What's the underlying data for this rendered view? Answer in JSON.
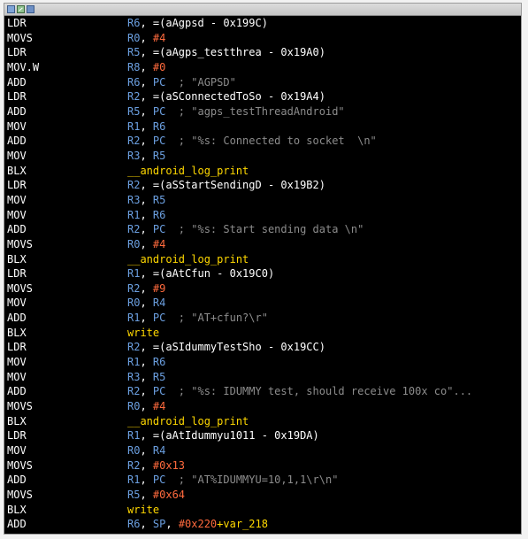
{
  "colors": {
    "background": "#000000",
    "mnemonic": "#ffffff",
    "register": "#6b9fe0",
    "immediate": "#ff6a3d",
    "function": "#ffd800",
    "comment": "#8c8c8c"
  },
  "titlebar": {
    "icons": [
      "view-icon",
      "graph-icon",
      "grid-icon"
    ]
  },
  "lines": [
    {
      "m": "LDR",
      "ops": [
        {
          "t": "R6",
          "k": "reg"
        },
        {
          "t": ", =(aAgpsd - 0x199C)",
          "k": "sym"
        }
      ]
    },
    {
      "m": "MOVS",
      "ops": [
        {
          "t": "R0",
          "k": "reg"
        },
        {
          "t": ", ",
          "k": "txt"
        },
        {
          "t": "#4",
          "k": "imm"
        }
      ]
    },
    {
      "m": "LDR",
      "ops": [
        {
          "t": "R5",
          "k": "reg"
        },
        {
          "t": ", =(aAgps_testthrea - 0x19A0)",
          "k": "sym"
        }
      ]
    },
    {
      "m": "MOV.W",
      "ops": [
        {
          "t": "R8",
          "k": "reg"
        },
        {
          "t": ", ",
          "k": "txt"
        },
        {
          "t": "#0",
          "k": "imm"
        }
      ]
    },
    {
      "m": "ADD",
      "ops": [
        {
          "t": "R6",
          "k": "reg"
        },
        {
          "t": ", ",
          "k": "txt"
        },
        {
          "t": "PC",
          "k": "reg"
        },
        {
          "t": "  ; \"AGPSD\"",
          "k": "cmt"
        }
      ]
    },
    {
      "m": "LDR",
      "ops": [
        {
          "t": "R2",
          "k": "reg"
        },
        {
          "t": ", =(aSConnectedToSo - 0x19A4)",
          "k": "sym"
        }
      ]
    },
    {
      "m": "ADD",
      "ops": [
        {
          "t": "R5",
          "k": "reg"
        },
        {
          "t": ", ",
          "k": "txt"
        },
        {
          "t": "PC",
          "k": "reg"
        },
        {
          "t": "  ; \"agps_testThreadAndroid\"",
          "k": "cmt"
        }
      ]
    },
    {
      "m": "MOV",
      "ops": [
        {
          "t": "R1",
          "k": "reg"
        },
        {
          "t": ", ",
          "k": "txt"
        },
        {
          "t": "R6",
          "k": "reg"
        }
      ]
    },
    {
      "m": "ADD",
      "ops": [
        {
          "t": "R2",
          "k": "reg"
        },
        {
          "t": ", ",
          "k": "txt"
        },
        {
          "t": "PC",
          "k": "reg"
        },
        {
          "t": "  ; \"%s: Connected to socket  \\n\"",
          "k": "cmt"
        }
      ]
    },
    {
      "m": "MOV",
      "ops": [
        {
          "t": "R3",
          "k": "reg"
        },
        {
          "t": ", ",
          "k": "txt"
        },
        {
          "t": "R5",
          "k": "reg"
        }
      ]
    },
    {
      "m": "BLX",
      "ops": [
        {
          "t": "__android_log_print",
          "k": "func"
        }
      ]
    },
    {
      "m": "LDR",
      "ops": [
        {
          "t": "R2",
          "k": "reg"
        },
        {
          "t": ", =(aSStartSendingD - 0x19B2)",
          "k": "sym"
        }
      ]
    },
    {
      "m": "MOV",
      "ops": [
        {
          "t": "R3",
          "k": "reg"
        },
        {
          "t": ", ",
          "k": "txt"
        },
        {
          "t": "R5",
          "k": "reg"
        }
      ]
    },
    {
      "m": "MOV",
      "ops": [
        {
          "t": "R1",
          "k": "reg"
        },
        {
          "t": ", ",
          "k": "txt"
        },
        {
          "t": "R6",
          "k": "reg"
        }
      ]
    },
    {
      "m": "ADD",
      "ops": [
        {
          "t": "R2",
          "k": "reg"
        },
        {
          "t": ", ",
          "k": "txt"
        },
        {
          "t": "PC",
          "k": "reg"
        },
        {
          "t": "  ; \"%s: Start sending data \\n\"",
          "k": "cmt"
        }
      ]
    },
    {
      "m": "MOVS",
      "ops": [
        {
          "t": "R0",
          "k": "reg"
        },
        {
          "t": ", ",
          "k": "txt"
        },
        {
          "t": "#4",
          "k": "imm"
        }
      ]
    },
    {
      "m": "BLX",
      "ops": [
        {
          "t": "__android_log_print",
          "k": "func"
        }
      ]
    },
    {
      "m": "LDR",
      "ops": [
        {
          "t": "R1",
          "k": "reg"
        },
        {
          "t": ", =(aAtCfun - 0x19C0)",
          "k": "sym"
        }
      ]
    },
    {
      "m": "MOVS",
      "ops": [
        {
          "t": "R2",
          "k": "reg"
        },
        {
          "t": ", ",
          "k": "txt"
        },
        {
          "t": "#9",
          "k": "imm"
        }
      ]
    },
    {
      "m": "MOV",
      "ops": [
        {
          "t": "R0",
          "k": "reg"
        },
        {
          "t": ", ",
          "k": "txt"
        },
        {
          "t": "R4",
          "k": "reg"
        }
      ]
    },
    {
      "m": "ADD",
      "ops": [
        {
          "t": "R1",
          "k": "reg"
        },
        {
          "t": ", ",
          "k": "txt"
        },
        {
          "t": "PC",
          "k": "reg"
        },
        {
          "t": "  ; \"AT+cfun?\\r\"",
          "k": "cmt"
        }
      ]
    },
    {
      "m": "BLX",
      "ops": [
        {
          "t": "write",
          "k": "func"
        }
      ]
    },
    {
      "m": "LDR",
      "ops": [
        {
          "t": "R2",
          "k": "reg"
        },
        {
          "t": ", =(aSIdummyTestSho - 0x19CC)",
          "k": "sym"
        }
      ]
    },
    {
      "m": "MOV",
      "ops": [
        {
          "t": "R1",
          "k": "reg"
        },
        {
          "t": ", ",
          "k": "txt"
        },
        {
          "t": "R6",
          "k": "reg"
        }
      ]
    },
    {
      "m": "MOV",
      "ops": [
        {
          "t": "R3",
          "k": "reg"
        },
        {
          "t": ", ",
          "k": "txt"
        },
        {
          "t": "R5",
          "k": "reg"
        }
      ]
    },
    {
      "m": "ADD",
      "ops": [
        {
          "t": "R2",
          "k": "reg"
        },
        {
          "t": ", ",
          "k": "txt"
        },
        {
          "t": "PC",
          "k": "reg"
        },
        {
          "t": "  ; \"%s: IDUMMY test, should receive 100x co\"...",
          "k": "cmt"
        }
      ]
    },
    {
      "m": "MOVS",
      "ops": [
        {
          "t": "R0",
          "k": "reg"
        },
        {
          "t": ", ",
          "k": "txt"
        },
        {
          "t": "#4",
          "k": "imm"
        }
      ]
    },
    {
      "m": "BLX",
      "ops": [
        {
          "t": "__android_log_print",
          "k": "func"
        }
      ]
    },
    {
      "m": "LDR",
      "ops": [
        {
          "t": "R1",
          "k": "reg"
        },
        {
          "t": ", =(aAtIdummyu1011 - 0x19DA)",
          "k": "sym"
        }
      ]
    },
    {
      "m": "MOV",
      "ops": [
        {
          "t": "R0",
          "k": "reg"
        },
        {
          "t": ", ",
          "k": "txt"
        },
        {
          "t": "R4",
          "k": "reg"
        }
      ]
    },
    {
      "m": "MOVS",
      "ops": [
        {
          "t": "R2",
          "k": "reg"
        },
        {
          "t": ", ",
          "k": "txt"
        },
        {
          "t": "#0x13",
          "k": "imm"
        }
      ]
    },
    {
      "m": "ADD",
      "ops": [
        {
          "t": "R1",
          "k": "reg"
        },
        {
          "t": ", ",
          "k": "txt"
        },
        {
          "t": "PC",
          "k": "reg"
        },
        {
          "t": "  ; \"AT%IDUMMYU=10,1,1\\r\\n\"",
          "k": "cmt"
        }
      ]
    },
    {
      "m": "MOVS",
      "ops": [
        {
          "t": "R5",
          "k": "reg"
        },
        {
          "t": ", ",
          "k": "txt"
        },
        {
          "t": "#0x64",
          "k": "imm"
        }
      ]
    },
    {
      "m": "BLX",
      "ops": [
        {
          "t": "write",
          "k": "func"
        }
      ]
    },
    {
      "m": "ADD",
      "ops": [
        {
          "t": "R6",
          "k": "reg"
        },
        {
          "t": ", ",
          "k": "txt"
        },
        {
          "t": "SP",
          "k": "reg"
        },
        {
          "t": ", ",
          "k": "txt"
        },
        {
          "t": "#0x220",
          "k": "imm"
        },
        {
          "t": "+var_218",
          "k": "func"
        }
      ]
    }
  ]
}
